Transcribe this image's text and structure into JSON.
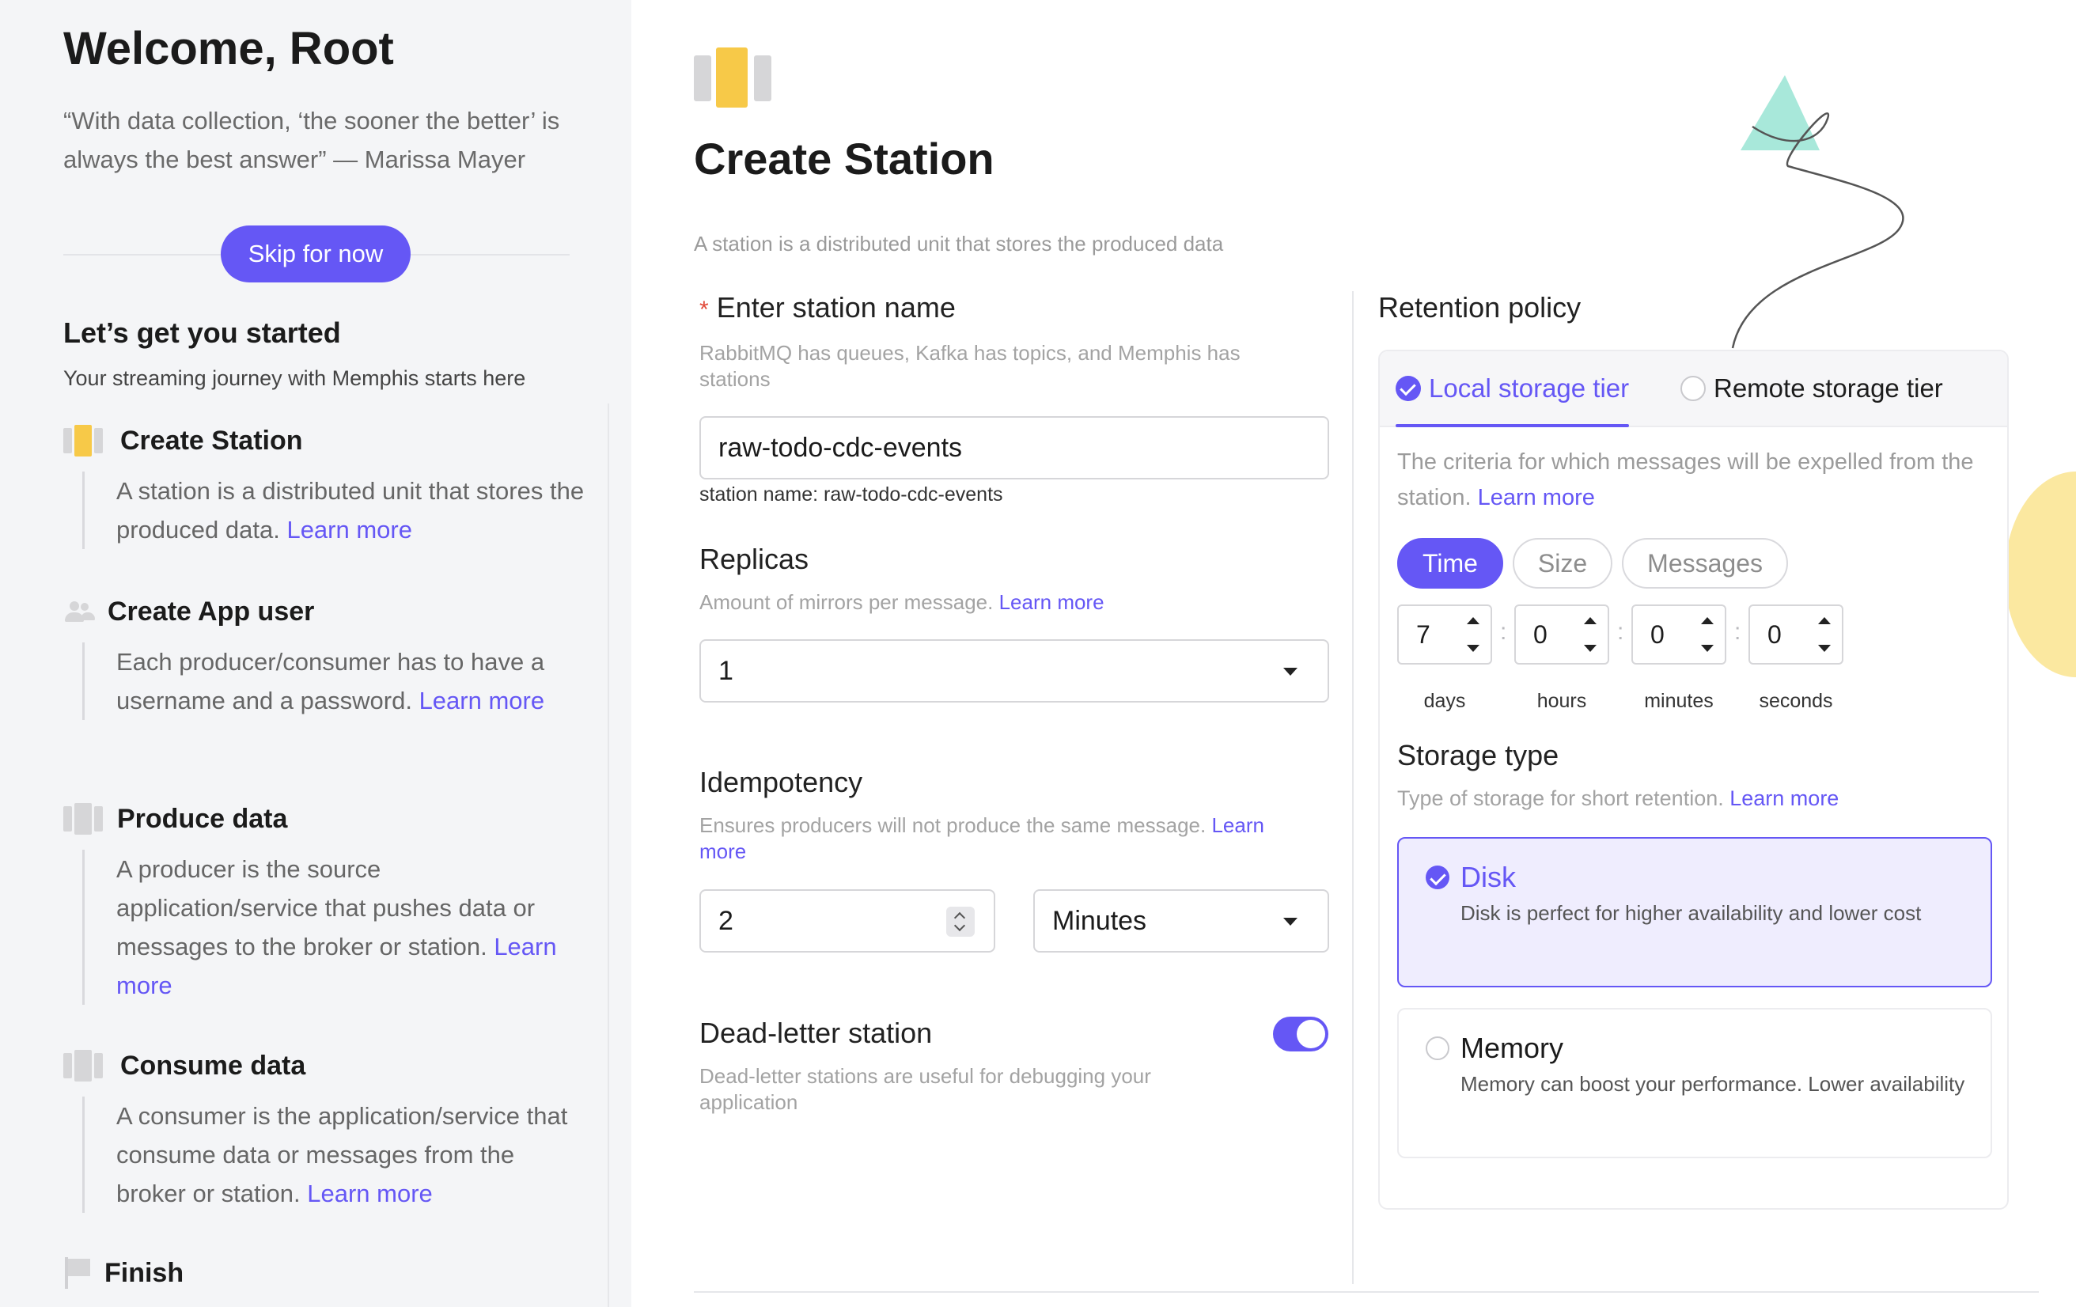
{
  "sidebar": {
    "title": "Welcome, Root",
    "quote": "“With data collection, ‘the sooner the better’ is always the best answer” — Marissa Mayer",
    "skip_label": "Skip for now",
    "section_title": "Let’s get you started",
    "section_subtitle": "Your streaming journey with Memphis starts here",
    "steps": [
      {
        "title": "Create Station",
        "body": "A station is a distributed unit that stores the produced data.",
        "link": "Learn more"
      },
      {
        "title": "Create App user",
        "body": "Each producer/consumer has to have a username and a password.",
        "link": "Learn more"
      },
      {
        "title": "Produce data",
        "body": "A producer is the source application/service that pushes data or messages to the broker or station.",
        "link": "Learn more"
      },
      {
        "title": "Consume data",
        "body": "A consumer is the application/service that consume data or messages from the broker or station.",
        "link": "Learn more"
      },
      {
        "title": "Finish"
      }
    ]
  },
  "main": {
    "title": "Create Station",
    "subtitle": "A station is a distributed unit that stores the produced data",
    "station_name": {
      "required_mark": "*",
      "label": "Enter station name",
      "hint": "RabbitMQ has queues, Kafka has topics, and Memphis has stations",
      "value": "raw-todo-cdc-events",
      "note": "station name: raw-todo-cdc-events"
    },
    "replicas": {
      "label": "Replicas",
      "hint": "Amount of mirrors per message.",
      "link": "Learn more",
      "value": "1"
    },
    "idempotency": {
      "label": "Idempotency",
      "hint": "Ensures producers will not produce the same message.",
      "link": "Learn more",
      "value": "2",
      "unit": "Minutes"
    },
    "dead_letter": {
      "label": "Dead-letter station",
      "hint": "Dead-letter stations are useful for debugging your application",
      "enabled": true
    }
  },
  "retention": {
    "title": "Retention policy",
    "tabs": [
      {
        "label": "Local storage tier",
        "active": true
      },
      {
        "label": "Remote storage tier",
        "active": false
      }
    ],
    "description": "The criteria for which messages will be expelled from the station.",
    "link": "Learn more",
    "modes": [
      {
        "label": "Time",
        "active": true
      },
      {
        "label": "Size",
        "active": false
      },
      {
        "label": "Messages",
        "active": false
      }
    ],
    "time": [
      {
        "value": "7",
        "unit": "days"
      },
      {
        "value": "0",
        "unit": "hours"
      },
      {
        "value": "0",
        "unit": "minutes"
      },
      {
        "value": "0",
        "unit": "seconds"
      }
    ],
    "time_separator": ":",
    "storage_type": {
      "title": "Storage type",
      "hint": "Type of storage for short retention.",
      "link": "Learn more",
      "options": [
        {
          "label": "Disk",
          "desc": "Disk is perfect for higher availability and lower cost",
          "selected": true
        },
        {
          "label": "Memory",
          "desc": "Memory can boost your performance. Lower availability",
          "selected": false
        }
      ]
    }
  },
  "colors": {
    "accent": "#6557f5",
    "station_yellow": "#f7c948",
    "deco_teal": "#a8e8da",
    "deco_yellow": "#fbe8a0"
  }
}
